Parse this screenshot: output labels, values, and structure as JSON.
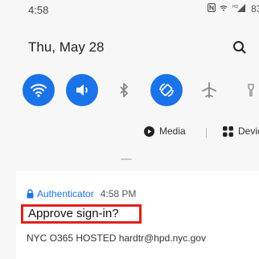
{
  "status": {
    "time": "4:58",
    "battery": "83",
    "signal_label": "HD"
  },
  "panel": {
    "date": "Thu, May 28",
    "quick_settings": [
      {
        "name": "wifi",
        "state": "on"
      },
      {
        "name": "sound",
        "state": "on"
      },
      {
        "name": "bluetooth",
        "state": "off"
      },
      {
        "name": "auto-rotate",
        "state": "on"
      },
      {
        "name": "airplane-mode",
        "state": "off"
      },
      {
        "name": "flashlight",
        "state": "off"
      }
    ],
    "media_label": "Media",
    "devices_label": "Devic"
  },
  "notification": {
    "app": "Authenticator",
    "time": "4:58 PM",
    "title": "Approve sign-in?",
    "body": "NYC O365 HOSTED hardtr@hpd.nyc.gov"
  },
  "colors": {
    "accent": "#1a73e8",
    "highlight_border": "#e0201b"
  }
}
